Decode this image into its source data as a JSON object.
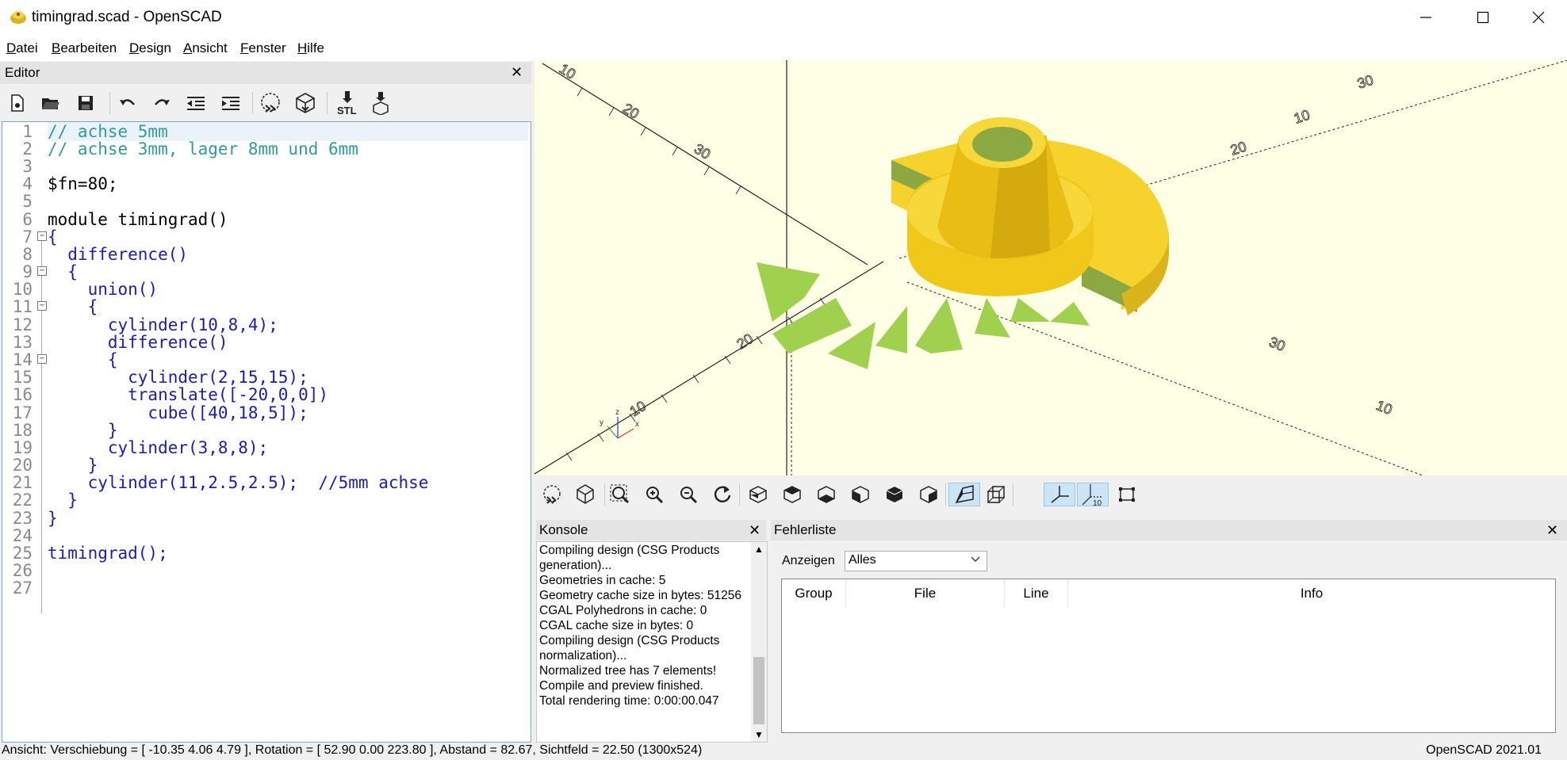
{
  "window": {
    "title": "timingrad.scad - OpenSCAD",
    "icon": "openscad-app-icon",
    "controls": [
      "minimize-icon",
      "maximize-icon",
      "close-icon"
    ]
  },
  "menu": [
    {
      "label": "Datei"
    },
    {
      "label": "Bearbeiten"
    },
    {
      "label": "Design"
    },
    {
      "label": "Ansicht"
    },
    {
      "label": "Fenster"
    },
    {
      "label": "Hilfe"
    }
  ],
  "editor": {
    "title": "Editor",
    "toolbar_icons": [
      "new-file-icon",
      "open-file-icon",
      "save-icon",
      "undo-icon",
      "redo-icon",
      "unindent-icon",
      "indent-icon",
      "preview-icon",
      "render-icon",
      "export-stl-icon",
      "send-to-print-icon"
    ],
    "stl_label": "STL",
    "code": [
      "// achse 5mm",
      "// achse 3mm, lager 8mm und 6mm",
      "",
      "$fn=80;",
      "",
      "module timingrad()",
      "{",
      "  difference()",
      "  {",
      "    union()",
      "    {",
      "      cylinder(10,8,4);",
      "      difference()",
      "      {",
      "        cylinder(2,15,15);",
      "        translate([-20,0,0])",
      "          cube([40,18,5]);",
      "      }",
      "      cylinder(3,8,8);",
      "    }",
      "    cylinder(11,2.5,2.5);  //5mm achse",
      "  }",
      "}",
      "",
      "timingrad();",
      "",
      ""
    ],
    "line_numbers": [
      "1",
      "2",
      "3",
      "4",
      "5",
      "6",
      "7",
      "8",
      "9",
      "10",
      "11",
      "12",
      "13",
      "14",
      "15",
      "16",
      "17",
      "18",
      "19",
      "20",
      "21",
      "22",
      "23",
      "24",
      "25",
      "26",
      "27"
    ]
  },
  "viewport": {
    "axis_ticks": [
      "10",
      "20",
      "30",
      "10",
      "20",
      "30",
      "10",
      "20",
      "30",
      "10"
    ],
    "axes_icon_labels": [
      "x",
      "y",
      "z"
    ],
    "colors": {
      "background": "#ffffe5",
      "model": "#f8d628",
      "model_shade": "#c8a800",
      "cut_face": "#9bc24a",
      "csg": "#9fd14f"
    }
  },
  "view_toolbar": {
    "icons": [
      "preview-icon",
      "render-icon",
      "view-all-icon",
      "zoom-in-icon",
      "zoom-out-icon",
      "reset-view-icon",
      "view-right-icon",
      "view-top-icon",
      "view-bottom-icon",
      "view-left-icon",
      "view-front-icon",
      "view-back-icon",
      "perspective-icon",
      "orthogonal-icon",
      "show-axes-icon",
      "show-scale-markers-icon",
      "show-edges-icon"
    ],
    "scale_label": "10"
  },
  "konsole": {
    "title": "Konsole",
    "lines": [
      "Compiling design (CSG Products generation)...",
      "Geometries in cache: 5",
      "Geometry cache size in bytes: 51256",
      "CGAL Polyhedrons in cache: 0",
      "CGAL cache size in bytes: 0",
      "Compiling design (CSG Products normalization)...",
      "Normalized tree has 7 elements!",
      "Compile and preview finished.",
      "Total rendering time: 0:00:00.047"
    ]
  },
  "fehlerliste": {
    "title": "Fehlerliste",
    "anzeigen_label": "Anzeigen",
    "filter_value": "Alles",
    "columns": [
      "Group",
      "File",
      "Line",
      "Info"
    ]
  },
  "status": {
    "left": "Ansicht: Verschiebung = [ -10.35 4.06 4.79 ], Rotation = [ 52.90 0.00 223.80 ], Abstand = 82.67, Sichtfeld = 22.50 (1300x524)",
    "right": "OpenSCAD 2021.01"
  }
}
